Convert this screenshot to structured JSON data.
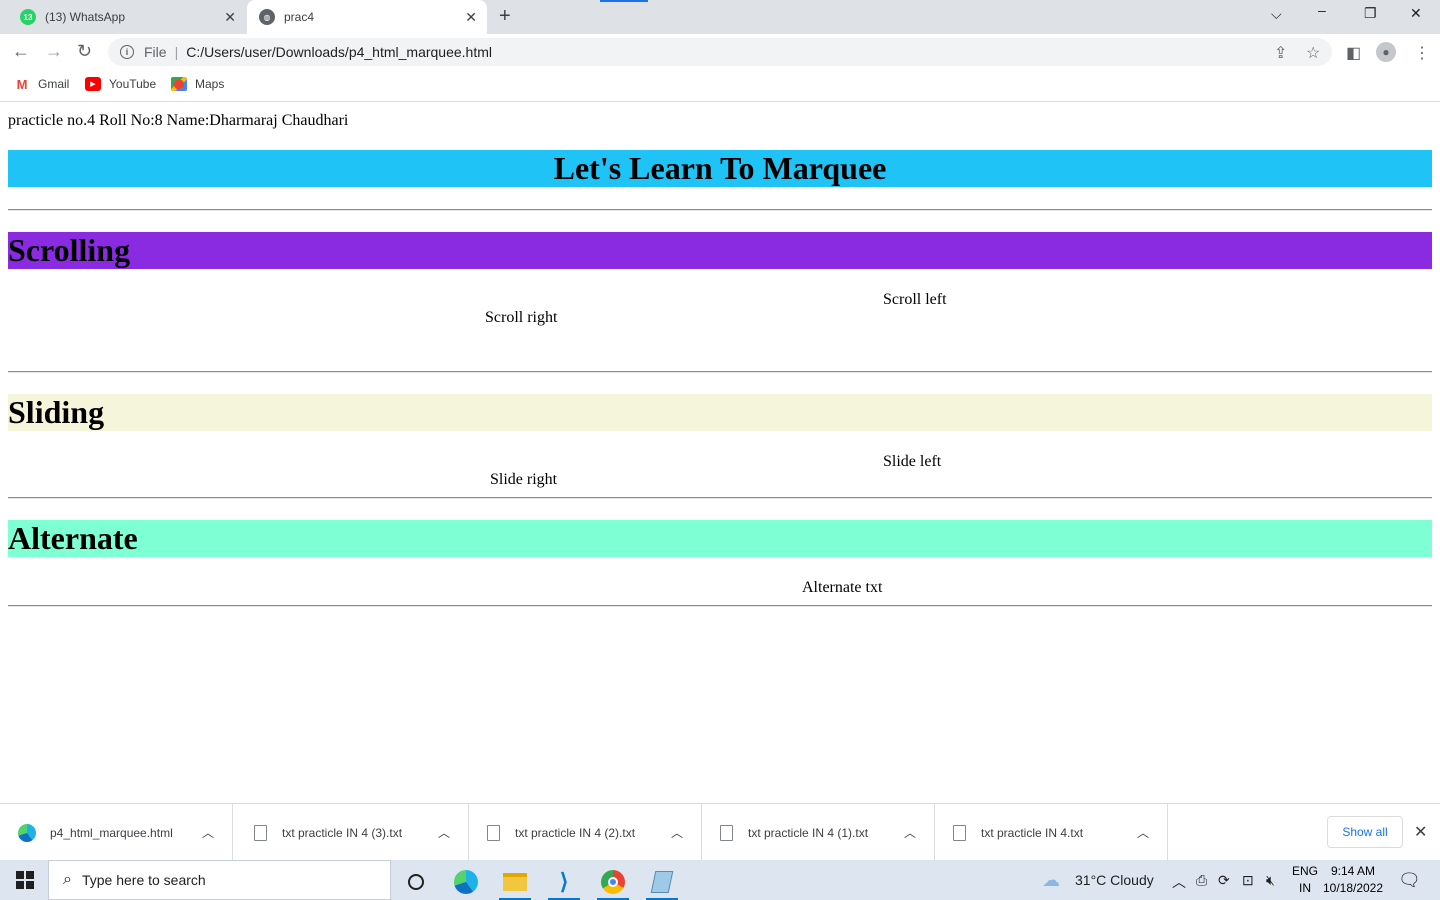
{
  "browser": {
    "tabs": [
      {
        "title": "(13) WhatsApp",
        "badge": "13"
      },
      {
        "title": "prac4"
      }
    ],
    "new_tab_symbol": "+",
    "omnibox": {
      "scheme": "File",
      "url": "C:/Users/user/Downloads/p4_html_marquee.html"
    },
    "bookmarks": [
      {
        "label": "Gmail",
        "icon": "gmail-icon"
      },
      {
        "label": "YouTube",
        "icon": "youtube-icon"
      },
      {
        "label": "Maps",
        "icon": "maps-icon"
      }
    ]
  },
  "page": {
    "intro": "practicle no.4 Roll No:8 Name:Dharmaraj Chaudhari",
    "title": "Let's Learn To Marquee",
    "title_bg": "#20c3f5",
    "sections": {
      "scrolling": {
        "heading": "Scrolling",
        "bg": "#8a2be2",
        "right_text": "Scroll right",
        "left_text": "Scroll left"
      },
      "sliding": {
        "heading": "Sliding",
        "bg": "#f5f5dc",
        "right_text": "Slide right",
        "left_text": "Slide left"
      },
      "alternate": {
        "heading": "Alternate",
        "bg": "#7fffd4",
        "text": "Alternate txt"
      }
    }
  },
  "downloads": {
    "items": [
      {
        "name": "p4_html_marquee.html",
        "icon": "edge-file-icon"
      },
      {
        "name": "txt practicle IN 4 (3).txt",
        "icon": "text-file-icon"
      },
      {
        "name": "txt practicle IN 4 (2).txt",
        "icon": "text-file-icon"
      },
      {
        "name": "txt practicle IN 4 (1).txt",
        "icon": "text-file-icon"
      },
      {
        "name": "txt practicle IN 4.txt",
        "icon": "text-file-icon"
      }
    ],
    "show_all": "Show all"
  },
  "taskbar": {
    "search_placeholder": "Type here to search",
    "weather": "31°C  Cloudy",
    "lang_line1": "ENG",
    "lang_line2": "IN",
    "time": "9:14 AM",
    "date": "10/18/2022"
  }
}
